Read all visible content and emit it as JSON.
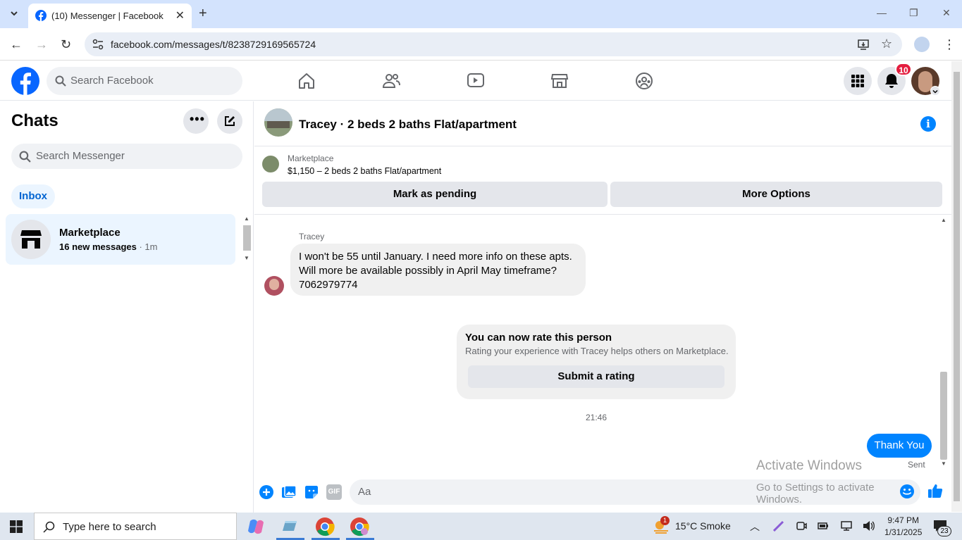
{
  "browser": {
    "tab_title": "(10) Messenger | Facebook",
    "url": "facebook.com/messages/t/8238729169565724"
  },
  "fb": {
    "search_placeholder": "Search Facebook",
    "notification_count": "10"
  },
  "sidebar": {
    "title": "Chats",
    "search_placeholder": "Search Messenger",
    "filter": "Inbox",
    "conversations": [
      {
        "name": "Marketplace",
        "preview": "16 new messages",
        "time": "1m"
      }
    ]
  },
  "chat": {
    "title": "Tracey · 2 beds 2 baths Flat/apartment",
    "listing_label": "Marketplace",
    "listing_price": "$1,150 – 2 beds 2 baths Flat/apartment",
    "mark_pending": "Mark as pending",
    "more_options": "More Options",
    "sender_name": "Tracey",
    "incoming_lines": [
      "I won't be 55 until January.  I need more info on these apts.",
      "Will more be available possibly in April May timeframe?",
      "7062979774"
    ],
    "rate_heading": "You can now rate this person",
    "rate_sub": "Rating your experience with Tracey helps others on Marketplace.",
    "rate_button": "Submit a rating",
    "timestamp": "21:46",
    "outgoing": "Thank You",
    "status": "Sent",
    "composer_placeholder": "Aa"
  },
  "watermark": {
    "line1": "Activate Windows",
    "line2": "Go to Settings to activate Windows."
  },
  "taskbar": {
    "search_placeholder": "Type here to search",
    "weather": "15°C  Smoke",
    "time": "9:47 PM",
    "date": "1/31/2025",
    "notif_count": "23",
    "weather_badge": "1"
  },
  "colors": {
    "fb_blue": "#0866ff",
    "messenger_blue": "#0084ff",
    "badge_red": "#e41e3f"
  }
}
